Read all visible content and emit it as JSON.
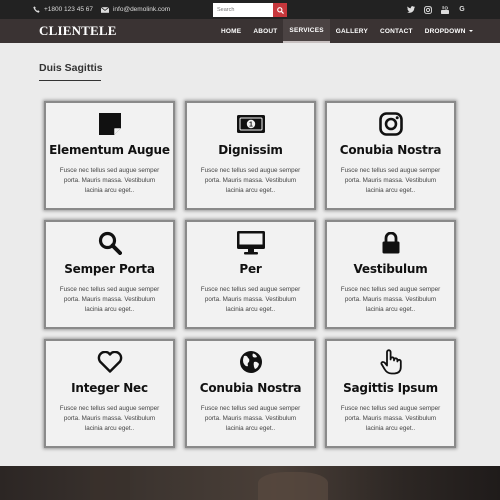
{
  "topbar": {
    "phone": "+1800 123 45 67",
    "email": "info@demolink.com",
    "search_placeholder": "Search",
    "social": [
      "twitter-icon",
      "instagram-icon",
      "youtube-icon",
      "google-icon"
    ],
    "google_letter": "G"
  },
  "navbar": {
    "brand": "CLIENTELE",
    "menu": [
      "HOME",
      "ABOUT",
      "SERVICES",
      "GALLERY",
      "CONTACT",
      "DROPDOWN"
    ],
    "active": "SERVICES"
  },
  "section": {
    "title": "Duis Sagittis"
  },
  "cards": [
    {
      "icon": "sticky-note-icon",
      "title": "Elementum Augue",
      "desc": "Fusce nec tellus sed augue semper porta. Mauris massa. Vestibulum lacinia arcu eget.."
    },
    {
      "icon": "money-icon",
      "title": "Dignissim",
      "desc": "Fusce nec tellus sed augue semper porta. Mauris massa. Vestibulum lacinia arcu eget.."
    },
    {
      "icon": "instagram-icon",
      "title": "Conubia Nostra",
      "desc": "Fusce nec tellus sed augue semper porta. Mauris massa. Vestibulum lacinia arcu eget.."
    },
    {
      "icon": "search-icon",
      "title": "Semper Porta",
      "desc": "Fusce nec tellus sed augue semper porta. Mauris massa. Vestibulum lacinia arcu eget.."
    },
    {
      "icon": "desktop-icon",
      "title": "Per",
      "desc": "Fusce nec tellus sed augue semper porta. Mauris massa. Vestibulum lacinia arcu eget.."
    },
    {
      "icon": "lock-icon",
      "title": "Vestibulum",
      "desc": "Fusce nec tellus sed augue semper porta. Mauris massa. Vestibulum lacinia arcu eget.."
    },
    {
      "icon": "heart-icon",
      "title": "Integer Nec",
      "desc": "Fusce nec tellus sed augue semper porta. Mauris massa. Vestibulum lacinia arcu eget.."
    },
    {
      "icon": "globe-icon",
      "title": "Conubia Nostra",
      "desc": "Fusce nec tellus sed augue semper porta. Mauris massa. Vestibulum lacinia arcu eget.."
    },
    {
      "icon": "pointer-hand-icon",
      "title": "Sagittis Ipsum",
      "desc": "Fusce nec tellus sed augue semper porta. Mauris massa. Vestibulum lacinia arcu eget.."
    }
  ],
  "colors": {
    "topbar": "#222222",
    "navbar": "#3a3333",
    "search_button": "#c7373c",
    "background": "#ebebeb"
  }
}
